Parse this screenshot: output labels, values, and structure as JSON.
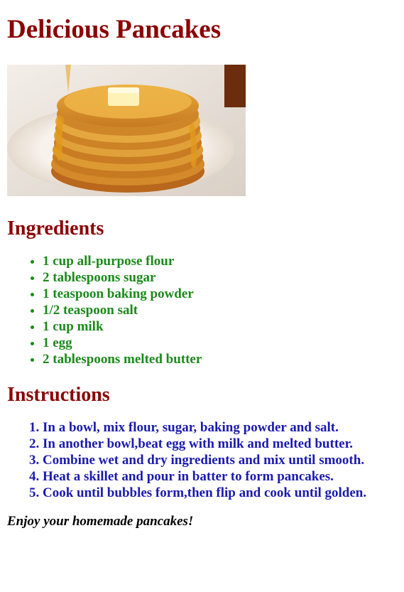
{
  "title": "Delicious Pancakes",
  "photo": {
    "subject": "stack of pancakes with butter and syrup"
  },
  "ingredients": {
    "heading": "Ingredients",
    "items": [
      "1 cup all-purpose flour",
      "2 tablespoons sugar",
      "1 teaspoon baking powder",
      "1/2 teaspoon salt",
      "1 cup milk",
      "1 egg",
      "2 tablespoons melted butter"
    ]
  },
  "instructions": {
    "heading": "Instructions",
    "steps": [
      "In a bowl, mix flour, sugar, baking powder and salt.",
      "In another bowl,beat egg with milk and melted butter.",
      "Combine wet and dry ingredients and mix until smooth.",
      "Heat a skillet and pour in batter to form pancakes.",
      "Cook until bubbles form,then flip and cook until golden."
    ]
  },
  "closing": "Enjoy your homemade pancakes!",
  "colors": {
    "heading": "#8b0000",
    "ingredients": "#1a8a1a",
    "instructions": "#1a1ab0"
  }
}
